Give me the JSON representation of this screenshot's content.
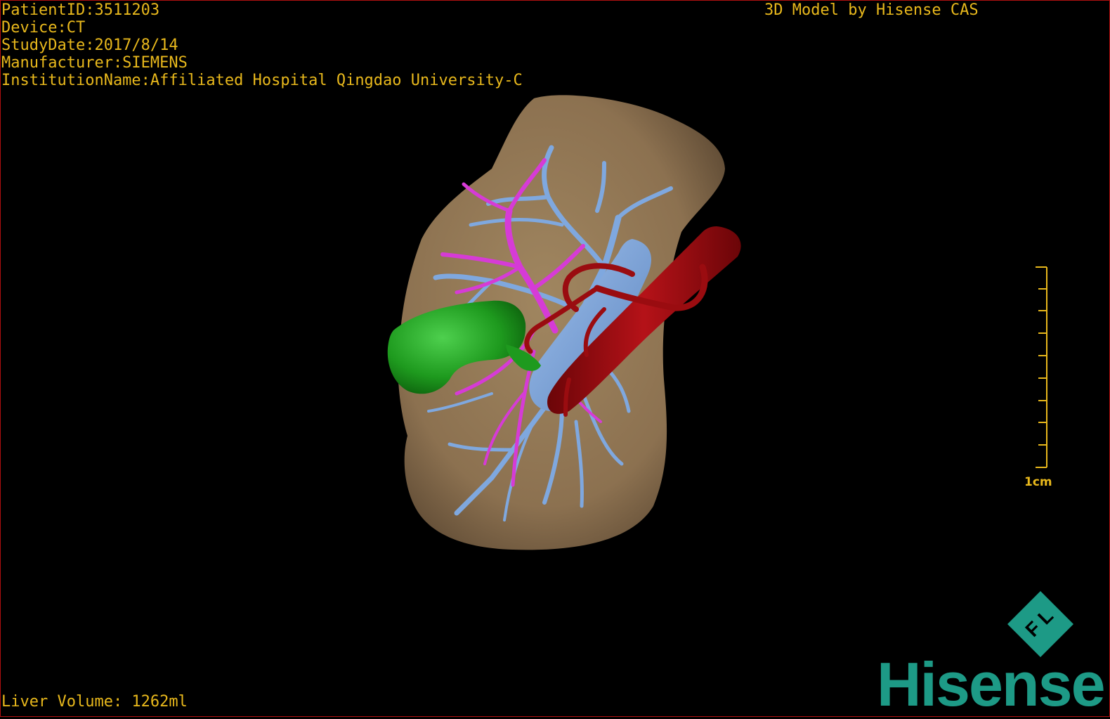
{
  "header": {
    "patient_id": "PatientID:3511203",
    "device": "Device:CT",
    "study_date": "StudyDate:2017/8/14",
    "manufacturer": "Manufacturer:SIEMENS",
    "institution": "InstitutionName:Affiliated Hospital Qingdao University-C"
  },
  "model_credit": "3D Model by Hisense CAS",
  "liver_volume": "Liver Volume: 1262ml",
  "scale_bar": {
    "label": "1cm"
  },
  "brand": {
    "name": "Hisense",
    "badge_letters": "F L"
  },
  "colors": {
    "overlay_text": "#e8b81c",
    "liver": "#8c7150",
    "portal_vein": "#7fa8df",
    "hepatic_vein": "#d63bd6",
    "artery": "#9a0c10",
    "gallbladder": "#1e9a1e",
    "brand": "#1d9a86",
    "frame": "#b01010"
  }
}
